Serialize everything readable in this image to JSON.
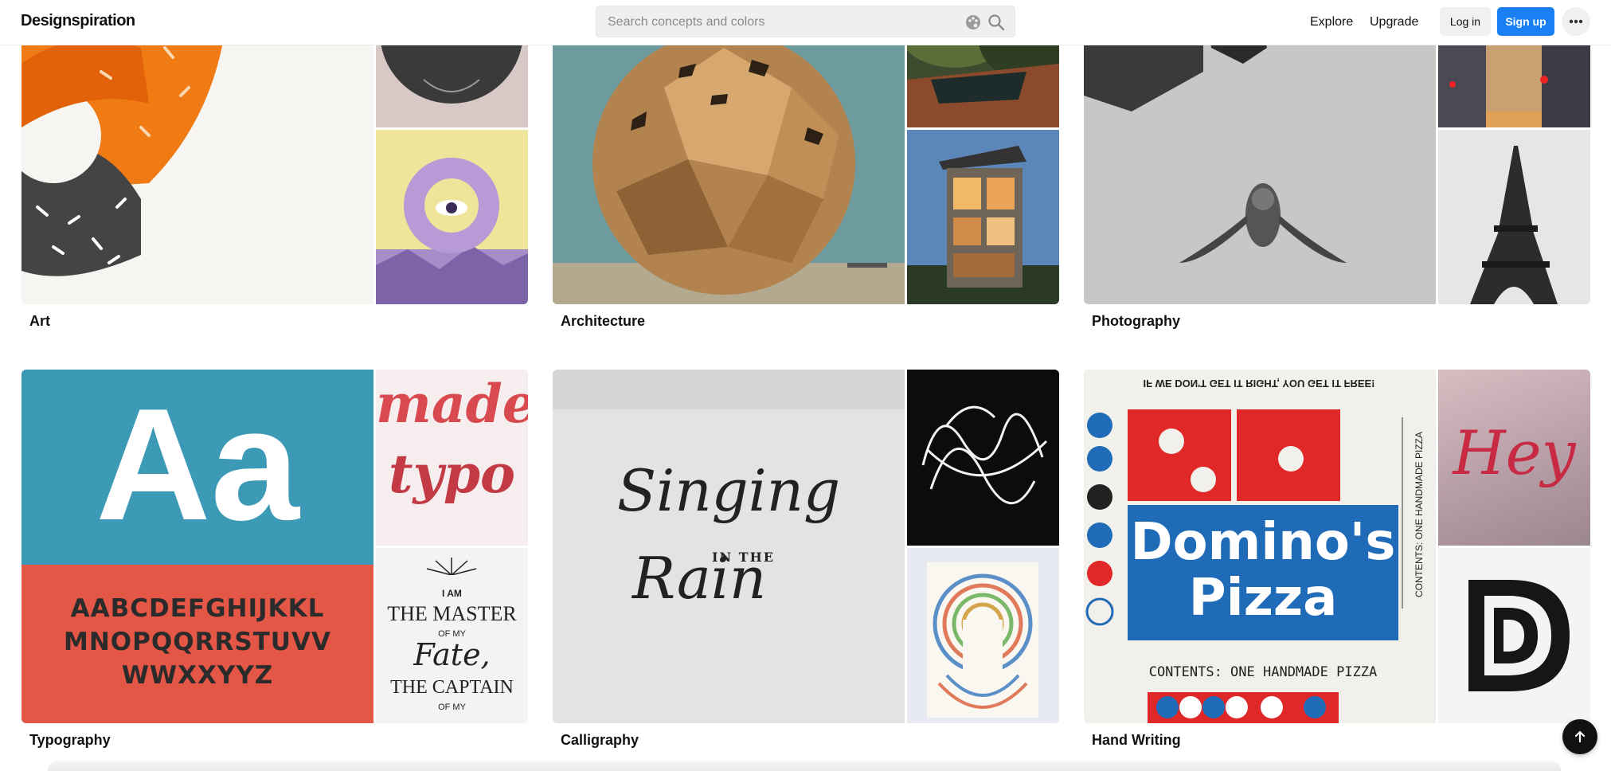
{
  "header": {
    "logo": "Designspiration",
    "search_placeholder": "Search concepts and colors",
    "nav": {
      "explore": "Explore",
      "upgrade": "Upgrade"
    },
    "login": "Log in",
    "signup": "Sign up",
    "more_icon": "more-dots-icon",
    "palette_icon": "color-palette-icon",
    "search_icon": "search-icon"
  },
  "collections": [
    {
      "label": "Art"
    },
    {
      "label": "Architecture"
    },
    {
      "label": "Photography"
    },
    {
      "label": "Typography"
    },
    {
      "label": "Calligraphy"
    },
    {
      "label": "Hand Writing"
    }
  ],
  "tile_text": {
    "typo_main": "Aa",
    "typo_alpha_1": "AABCDEFGHIJKKL",
    "typo_alpha_2": "MNOPQQRRSTUVV",
    "typo_alpha_3": "WWXXYYZ",
    "made": "made",
    "typo": "typo",
    "poster_1": "I AM",
    "poster_2": "THE MASTER",
    "poster_3": "OF MY",
    "poster_4": "Fate,",
    "poster_5": "THE CAPTAIN",
    "poster_6": "OF MY",
    "calli_1": "Singing",
    "calli_2": "IN THE",
    "calli_3": "Rain",
    "pizza_top": "IF WE DON'T GET IT RIGHT, YOU GET IT FREE!",
    "pizza_1": "Domino's",
    "pizza_2": "Pizza",
    "pizza_contents": "CONTENTS: ONE HANDMADE PIZZA",
    "pizza_side": "CONTENTS: ONE HANDMADE PIZZA",
    "hey": "Hey"
  },
  "scroll_top_icon": "arrow-up-icon",
  "colors": {
    "accent": "#1a7ff2",
    "text": "#111111",
    "search_bg": "#efefef"
  }
}
